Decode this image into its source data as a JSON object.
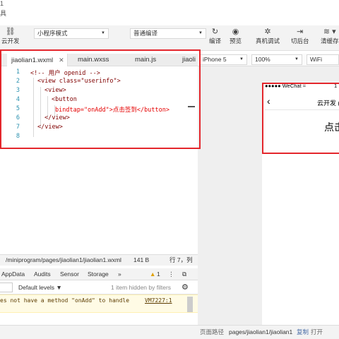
{
  "menu": {
    "char1": "1",
    "char2": "具"
  },
  "toolbar": {
    "cloud_label": "云开发",
    "mode_select": "小程序模式",
    "compile_select": "普通编译",
    "compile_label": "编译",
    "preview_label": "预览",
    "debug_label": "真机调试",
    "background_label": "切后台",
    "clearcache_label": "清缓存"
  },
  "editor": {
    "tabs": [
      {
        "label": "jiaolian1.wxml"
      },
      {
        "label": "main.wxss"
      },
      {
        "label": "main.js"
      },
      {
        "label": "jiaoli"
      }
    ],
    "lines": [
      {
        "n": "1",
        "text": "<!-- 用户 openid -->"
      },
      {
        "n": "2",
        "text": "<view class=\"userinfo\">"
      },
      {
        "n": "3",
        "text": "<view>"
      },
      {
        "n": "4",
        "text": "<button"
      },
      {
        "n": "5",
        "text": "bindtap=\"onAdd\">点击签到</button>"
      },
      {
        "n": "6",
        "text": "</view>"
      },
      {
        "n": "7",
        "text": "</view>"
      },
      {
        "n": "8",
        "text": ""
      }
    ]
  },
  "simulator": {
    "device": "iPhone 5",
    "zoom": "100%",
    "network": "WiFi",
    "status_left": "●●●●● WeChat",
    "status_right": "1",
    "nav_title": "云开发 (",
    "signin_text": "点击"
  },
  "pathbar": {
    "path": "/miniprogram/pages/jiaolian1/jiaolian1.wxml",
    "size": "141 B",
    "cursor": "行 7，列"
  },
  "devtools": {
    "tabs": [
      "AppData",
      "Audits",
      "Sensor",
      "Storage"
    ],
    "more": "»",
    "warn_count": "1",
    "levels": "Default levels",
    "hidden": "1 item hidden by filters",
    "warning_text": "es not have a method \"onAdd\" to handle",
    "warning_src": "VM7227:1"
  },
  "bottom": {
    "label": "页面路径",
    "path": "pages/jiaolian1/jiaolian1",
    "copy": "复制",
    "open": "打开"
  },
  "colors": {
    "highlight_box": "#e4262c",
    "link": "#4a6da7"
  }
}
